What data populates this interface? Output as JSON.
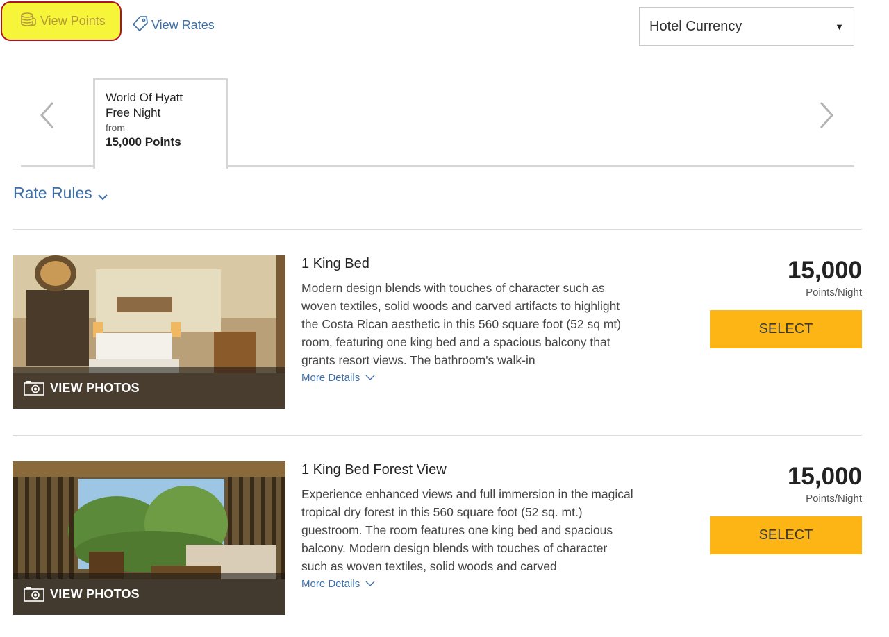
{
  "toolbar": {
    "view_points_label": "View Points",
    "view_rates_label": "View Rates",
    "currency_selected": "Hotel Currency"
  },
  "rate_tabs": [
    {
      "line1": "World Of Hyatt",
      "line2": "Free Night",
      "from_label": "from",
      "price": "15,000 Points"
    }
  ],
  "rate_rules_label": "Rate Rules",
  "rooms": [
    {
      "name": "1 King Bed",
      "description": "Modern design blends with touches of character such as woven textiles, solid woods and carved artifacts to highlight the Costa Rican aesthetic in this 560 square foot (52 sq mt) room, featuring one king bed and a spacious balcony that grants resort views. The bathroom's walk-in",
      "photos_label": "VIEW PHOTOS",
      "more_details_label": "More Details",
      "price": "15,000",
      "price_unit": "Points/Night",
      "select_label": "SELECT"
    },
    {
      "name": "1 King Bed Forest View",
      "description": "Experience enhanced views and full immersion in the magical tropical dry forest in this 560 square foot (52 sq. mt.) guestroom. The room features one king bed and spacious balcony. Modern design blends with touches of character such as woven textiles, solid woods and carved",
      "photos_label": "VIEW PHOTOS",
      "more_details_label": "More Details",
      "price": "15,000",
      "price_unit": "Points/Night",
      "select_label": "SELECT"
    }
  ],
  "colors": {
    "link_blue": "#3d6fa8",
    "select_button": "#fdb515",
    "highlight_yellow": "#f6f53a",
    "highlight_border": "#b0122c"
  },
  "icons": [
    "coins-icon",
    "price-tag-icon",
    "chevron-left-icon",
    "chevron-right-icon",
    "chevron-down-icon",
    "camera-icon"
  ]
}
